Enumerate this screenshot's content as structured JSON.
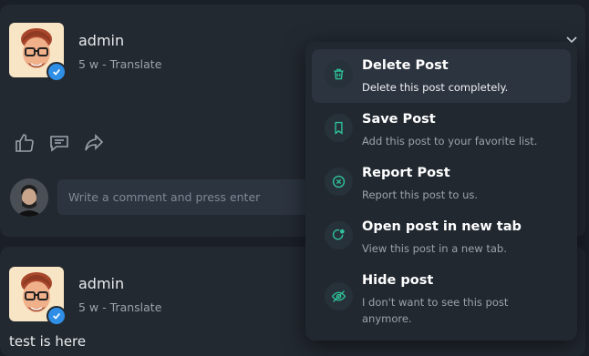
{
  "post1": {
    "username": "admin",
    "time": "5 w",
    "separator": " - ",
    "translate": "Translate",
    "comment_placeholder": "Write a comment and press enter"
  },
  "post2": {
    "username": "admin",
    "time": "5 w",
    "separator": " - ",
    "translate": "Translate",
    "text": "test is here"
  },
  "dropdown": {
    "items": [
      {
        "icon": "trash-icon",
        "title": "Delete Post",
        "desc": "Delete this post completely."
      },
      {
        "icon": "bookmark-icon",
        "title": "Save Post",
        "desc": "Add this post to your favorite list."
      },
      {
        "icon": "report-icon",
        "title": "Report Post",
        "desc": "Report this post to us."
      },
      {
        "icon": "open-tab-icon",
        "title": "Open post in new tab",
        "desc": "View this post in a new tab."
      },
      {
        "icon": "eye-off-icon",
        "title": "Hide post",
        "desc": "I don't want to see this post anymore."
      }
    ]
  },
  "colors": {
    "accent": "#2fc39a",
    "verified": "#2f8fe6",
    "background": "#1b1f27",
    "card": "#232931"
  }
}
